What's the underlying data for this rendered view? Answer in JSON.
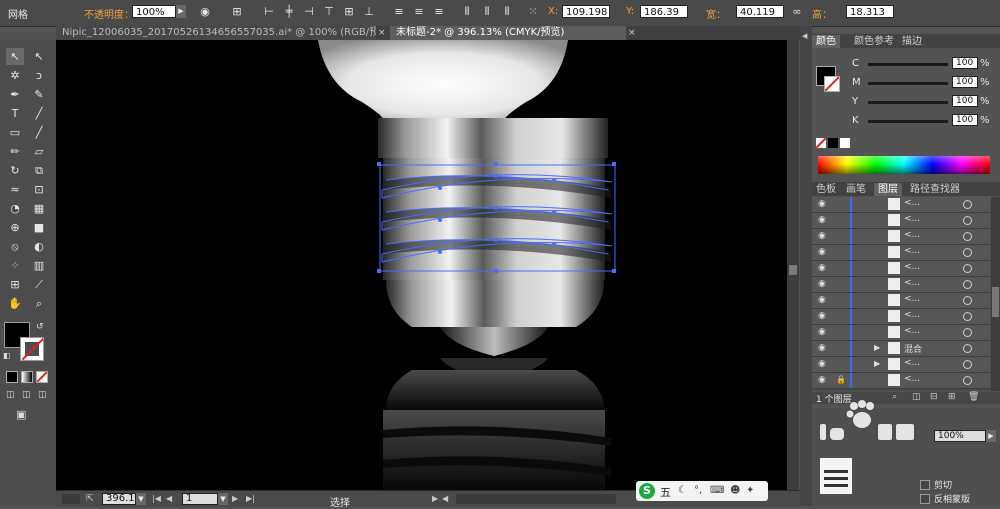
{
  "control_bar": {
    "workspace_label": "网格",
    "opacity_label": "不透明度：",
    "opacity_value": "100%",
    "x_label": "X:",
    "x_value": "109.198",
    "y_label": "Y:",
    "y_value": "186.39",
    "width_label": "宽：",
    "width_value": "40.119",
    "height_label": "高：",
    "height_value": "18.313"
  },
  "tabs": [
    {
      "label": "Nipic_12006035_20170526134656557035.ai* @ 100% (RGB/预览)"
    },
    {
      "label": "未标题-2* @ 396.13% (CMYK/预览)"
    }
  ],
  "color_panel": {
    "tabs": [
      "颜色",
      "颜色参考",
      "描边"
    ],
    "sliders": [
      {
        "label": "C",
        "value": "100"
      },
      {
        "label": "M",
        "value": "100"
      },
      {
        "label": "Y",
        "value": "100"
      },
      {
        "label": "K",
        "value": "100"
      }
    ]
  },
  "layers_panel": {
    "tabs": [
      "色板",
      "画笔",
      "图层",
      "路径查找器"
    ],
    "rows": [
      {
        "name": "<...",
        "expand": ""
      },
      {
        "name": "<...",
        "expand": ""
      },
      {
        "name": "<...",
        "expand": ""
      },
      {
        "name": "<...",
        "expand": ""
      },
      {
        "name": "<...",
        "expand": ""
      },
      {
        "name": "<...",
        "expand": ""
      },
      {
        "name": "<...",
        "expand": ""
      },
      {
        "name": "<...",
        "expand": ""
      },
      {
        "name": "<...",
        "expand": ""
      },
      {
        "name": "混合",
        "expand": "▶"
      },
      {
        "name": "<...",
        "expand": "▶"
      },
      {
        "name": "<...",
        "expand": ""
      }
    ],
    "footer_label": "1 个图层"
  },
  "transparency_panel": {
    "opacity_value": "100%",
    "clip_label": "剪切",
    "invert_mask_label": "反相蒙版"
  },
  "status_bar": {
    "zoom": "396.13",
    "page": "1",
    "tool_label": "选择"
  },
  "ime_bar": {
    "logo": "S",
    "mode_label": "五"
  },
  "colors": {
    "canvas_bg": "#000000",
    "selection_path": "#4a6bff",
    "spectrum": [
      "#ff0000",
      "#ffff00",
      "#00ff00",
      "#00ffff",
      "#0000ff",
      "#ff00ff",
      "#ff0000"
    ]
  }
}
